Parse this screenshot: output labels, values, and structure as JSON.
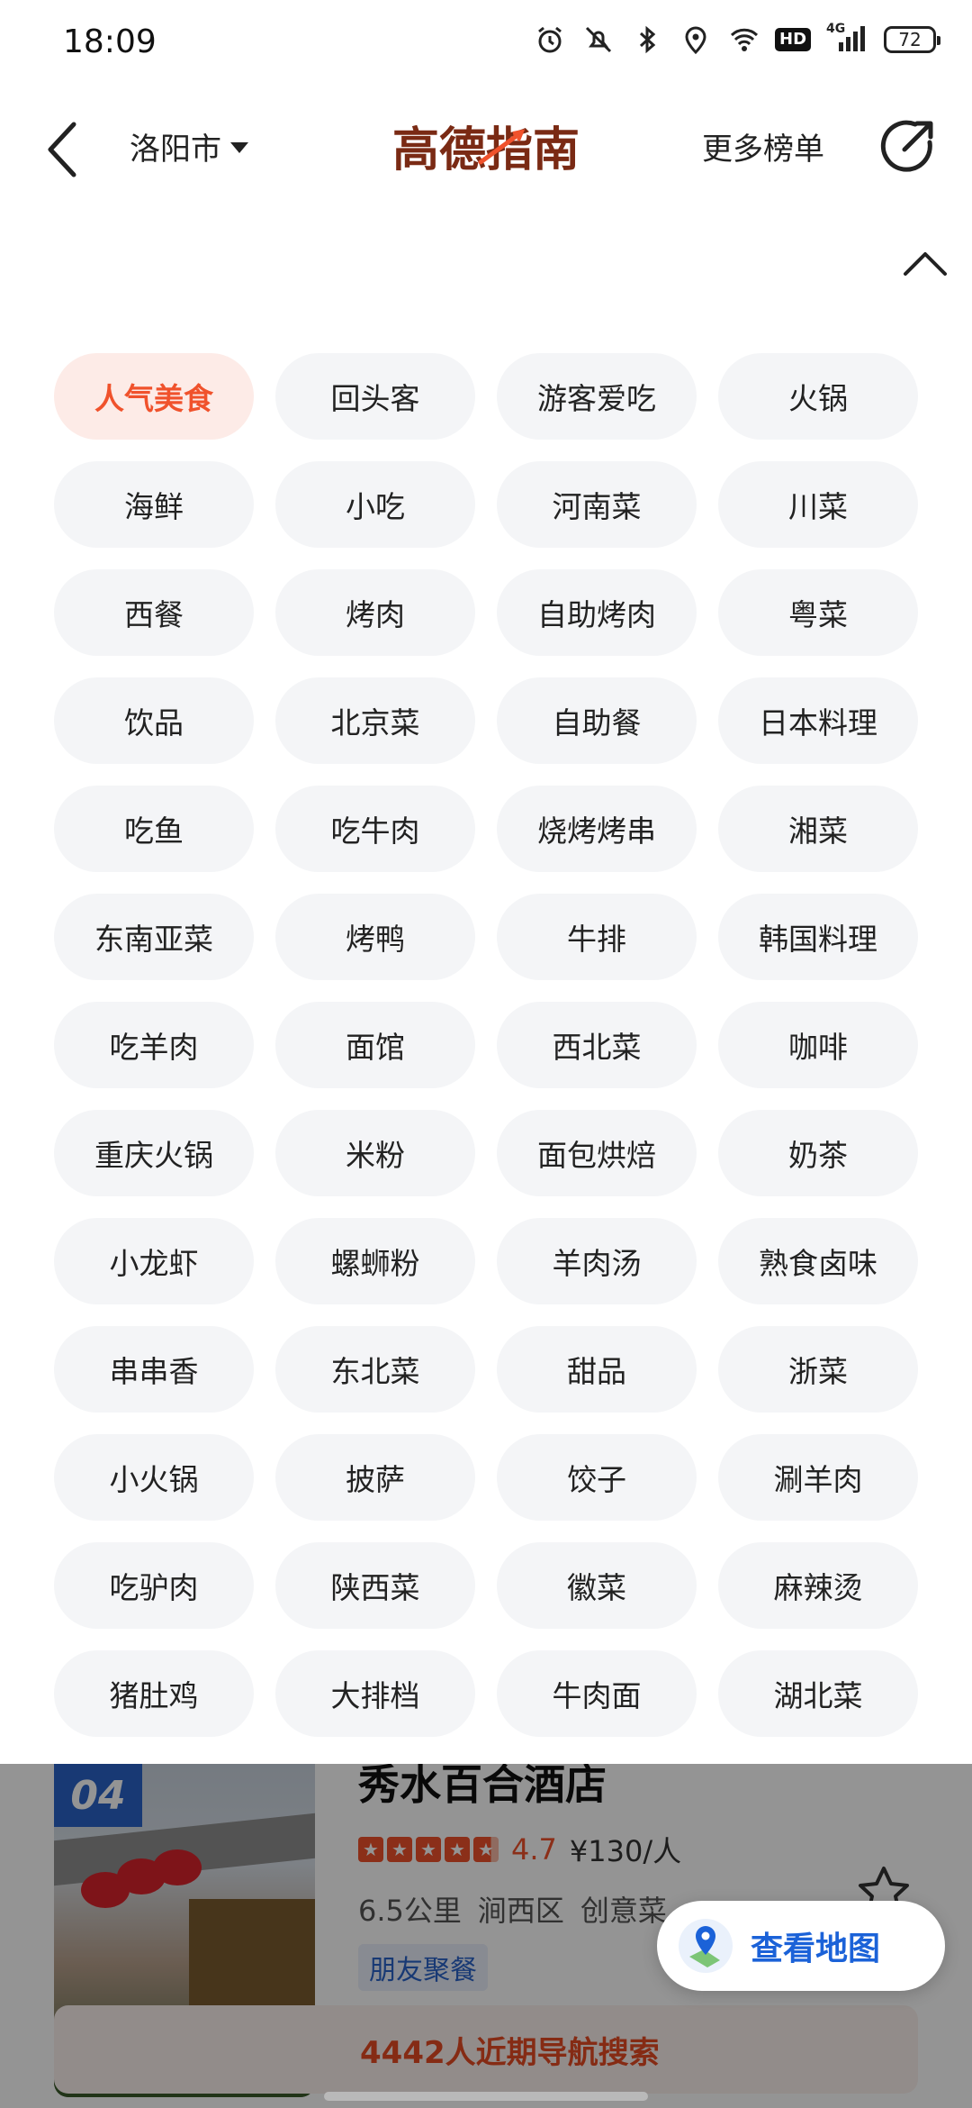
{
  "status_bar": {
    "time": "18:09",
    "network": "4G",
    "hd": "HD",
    "battery": "72",
    "icons": [
      "alarm-icon",
      "mute-icon",
      "bluetooth-icon",
      "location-icon",
      "wifi-icon",
      "hd-icon",
      "signal-icon",
      "battery-icon"
    ]
  },
  "nav": {
    "city": "洛阳市",
    "logo_text": "高德指南",
    "more_lists": "更多榜单"
  },
  "categories": [
    "人气美食",
    "回头客",
    "游客爱吃",
    "火锅",
    "海鲜",
    "小吃",
    "河南菜",
    "川菜",
    "西餐",
    "烤肉",
    "自助烤肉",
    "粤菜",
    "饮品",
    "北京菜",
    "自助餐",
    "日本料理",
    "吃鱼",
    "吃牛肉",
    "烧烤烤串",
    "湘菜",
    "东南亚菜",
    "烤鸭",
    "牛排",
    "韩国料理",
    "吃羊肉",
    "面馆",
    "西北菜",
    "咖啡",
    "重庆火锅",
    "米粉",
    "面包烘焙",
    "奶茶",
    "小龙虾",
    "螺蛳粉",
    "羊肉汤",
    "熟食卤味",
    "串串香",
    "东北菜",
    "甜品",
    "浙菜",
    "小火锅",
    "披萨",
    "饺子",
    "涮羊肉",
    "吃驴肉",
    "陕西菜",
    "徽菜",
    "麻辣烫",
    "猪肚鸡",
    "大排档",
    "牛肉面",
    "湖北菜"
  ],
  "active_category_index": 0,
  "listing": {
    "rank": "04",
    "name": "秀水百合酒店",
    "rating": 4.7,
    "score": "4.7",
    "price": "¥130/人",
    "distance": "6.5公里",
    "district": "涧西区",
    "cuisine": "创意菜",
    "tag": "朋友聚餐",
    "search_note": "4442人近期导航搜索"
  },
  "map_button": {
    "label": "查看地图"
  },
  "colors": {
    "accent": "#f0522c",
    "link_blue": "#1b62d8",
    "pill_bg": "#f4f5f7",
    "active_pill_bg": "#fdebe7"
  }
}
